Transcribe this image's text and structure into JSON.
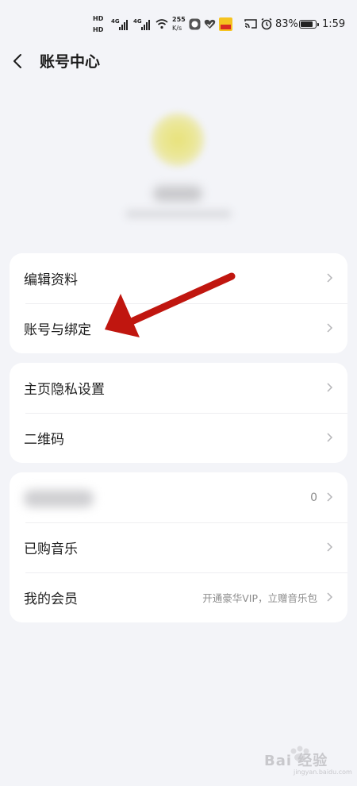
{
  "status_bar": {
    "net_speed_top": "255",
    "net_speed_bottom": "K/s",
    "sim1_tag": "HD",
    "sim2_tag": "HD",
    "net1": "4G",
    "net2": "4G",
    "battery_pct": "83%",
    "time": "1:59",
    "battery_level": 0.83
  },
  "header": {
    "title": "账号中心"
  },
  "sections": {
    "card1": {
      "edit_profile": "编辑资料",
      "account_binding": "账号与绑定"
    },
    "card2": {
      "homepage_privacy": "主页隐私设置",
      "qr_code": "二维码"
    },
    "card3": {
      "hidden_item_value": "0",
      "purchased_music": "已购音乐",
      "my_membership": "我的会员",
      "membership_promo": "开通豪华VIP，立赠音乐包"
    }
  },
  "watermark": {
    "text": "Bai 经验",
    "sub": "jingyan.baidu.com"
  },
  "colors": {
    "background": "#f3f4f8",
    "card": "#ffffff",
    "annotation_arrow": "#c0160f",
    "secondary_text": "#8c8c8c"
  }
}
